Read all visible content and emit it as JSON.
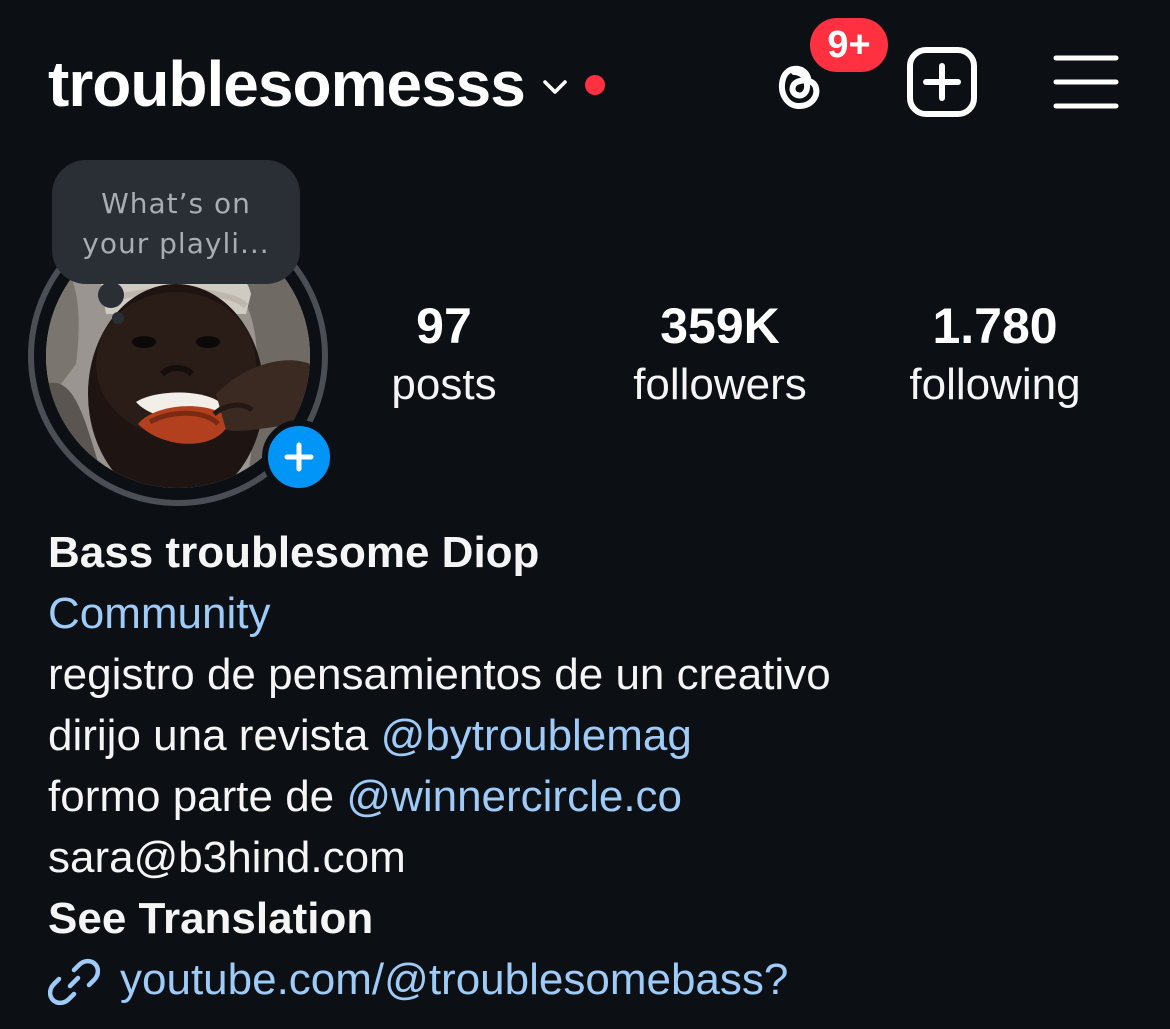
{
  "header": {
    "username": "troublesomesss",
    "notification_badge": "9+",
    "accent_red": "#ff3040",
    "icons": [
      "chevron-down-icon",
      "threads-icon",
      "new-post-icon",
      "menu-icon"
    ]
  },
  "profile": {
    "note": {
      "line1": "What’s on",
      "line2": "your playli..."
    },
    "add_story_color": "#0095f6",
    "stats": [
      {
        "value": "97",
        "label": "posts"
      },
      {
        "value": "359K",
        "label": "followers"
      },
      {
        "value": "1.780",
        "label": "following"
      }
    ]
  },
  "bio": {
    "name": "Bass troublesome Diop",
    "category": "Community",
    "line1": "registro de pensamientos de un creativo",
    "line2_text": "dirijo una revista ",
    "line2_mention": "@bytroublemag",
    "line3_text": "formo parte de ",
    "line3_mention": "@winnercircle.co",
    "email": "sara@b3hind.com",
    "see_translation": "See Translation",
    "link": "youtube.com/@troublesomebass?",
    "link_color": "#9ecbf7"
  }
}
